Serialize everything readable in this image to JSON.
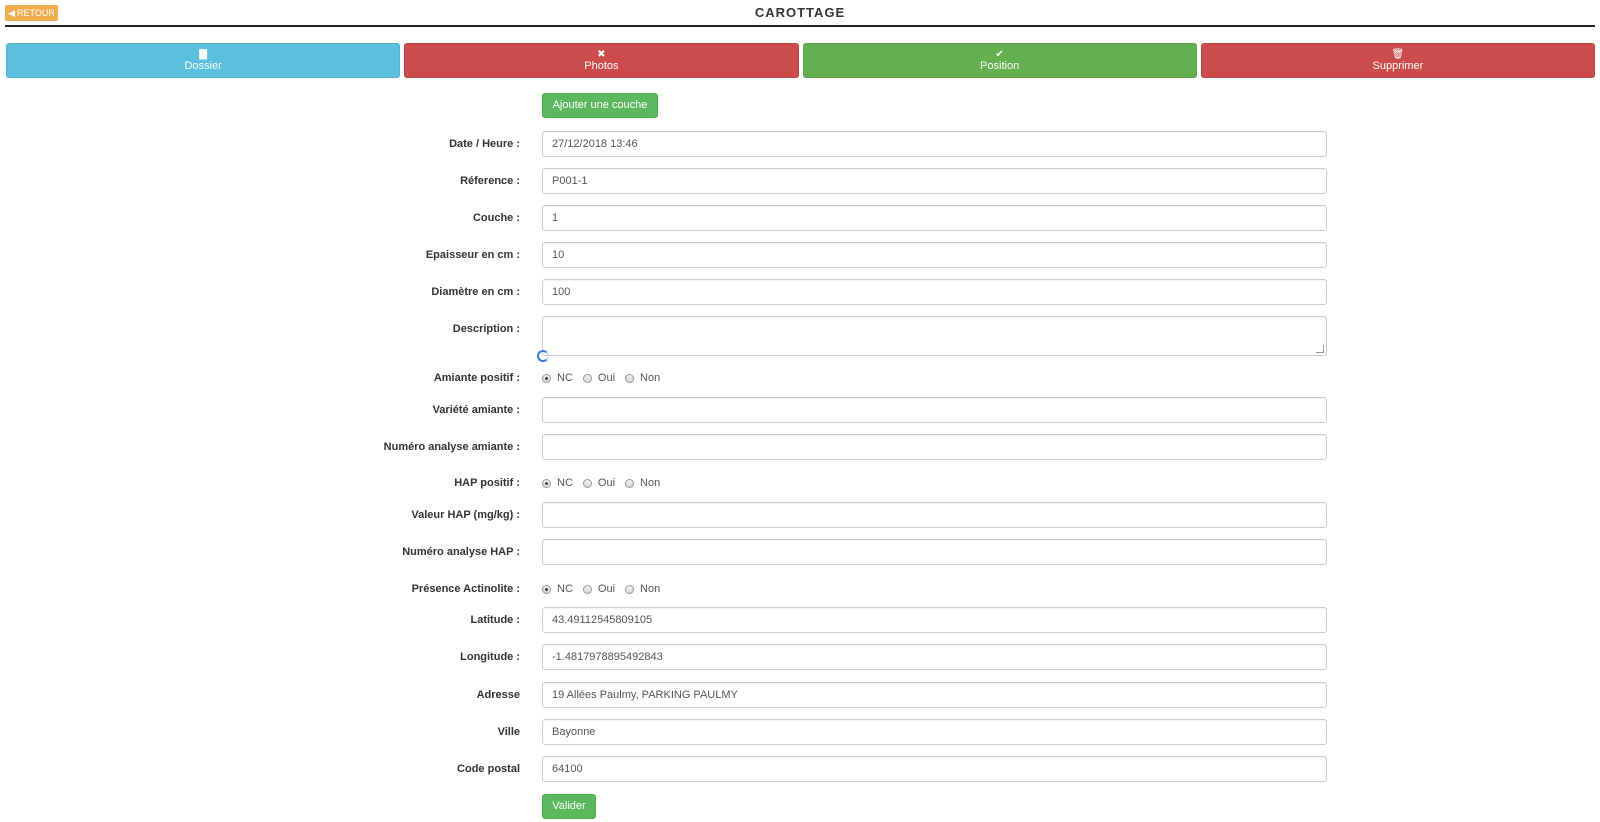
{
  "header": {
    "back_label": "RETOUR",
    "back_icon": "arrow-left-icon",
    "title": "CAROTTAGE"
  },
  "tabs": [
    {
      "label": "Dossier",
      "icon": "folder-icon",
      "glyph": "▇",
      "color": "#5bc0de"
    },
    {
      "label": "Photos",
      "icon": "close-icon",
      "glyph": "✖",
      "color": "#cc4b4b"
    },
    {
      "label": "Position",
      "icon": "check-icon",
      "glyph": "✔",
      "color": "#64b050"
    },
    {
      "label": "Supprimer",
      "icon": "trash-icon",
      "glyph": "🗑",
      "color": "#cc4b4b"
    }
  ],
  "form": {
    "add_layer_label": "Ajouter une couche",
    "date": {
      "label": "Date / Heure :",
      "value": "27/12/2018 13:46"
    },
    "reference": {
      "label": "Réference :",
      "value": "P001-1"
    },
    "couche": {
      "label": "Couche :",
      "value": "1"
    },
    "epaisseur": {
      "label": "Epaisseur en cm :",
      "value": "10"
    },
    "diametre": {
      "label": "Diamètre en cm :",
      "value": "100"
    },
    "description": {
      "label": "Description :",
      "value": ""
    },
    "amiante_positif": {
      "label": "Amiante positif :",
      "options": [
        "NC",
        "Oui",
        "Non"
      ],
      "selected": "NC"
    },
    "variete_amiante": {
      "label": "Variété amiante :",
      "value": ""
    },
    "numero_analyse_amiante": {
      "label": "Numéro analyse amiante :",
      "value": ""
    },
    "hap_positif": {
      "label": "HAP positif :",
      "options": [
        "NC",
        "Oui",
        "Non"
      ],
      "selected": "NC"
    },
    "valeur_hap": {
      "label": "Valeur HAP (mg/kg) :",
      "value": ""
    },
    "numero_analyse_hap": {
      "label": "Numéro analyse HAP :",
      "value": ""
    },
    "presence_actinolite": {
      "label": "Présence Actinolite :",
      "options": [
        "NC",
        "Oui",
        "Non"
      ],
      "selected": "NC"
    },
    "latitude": {
      "label": "Latitude :",
      "value": "43.49112545809105"
    },
    "longitude": {
      "label": "Longitude :",
      "value": "-1.4817978895492843"
    },
    "adresse": {
      "label": "Adresse",
      "value": "19 Allées Paulmy, PARKING PAULMY"
    },
    "ville": {
      "label": "Ville",
      "value": "Bayonne"
    },
    "code_postal": {
      "label": "Code postal",
      "value": "64100"
    },
    "submit_label": "Valider"
  },
  "colors": {
    "warning": "#f0ad4e",
    "info": "#5bc0de",
    "danger": "#cc4b4b",
    "success": "#5cb85c"
  }
}
